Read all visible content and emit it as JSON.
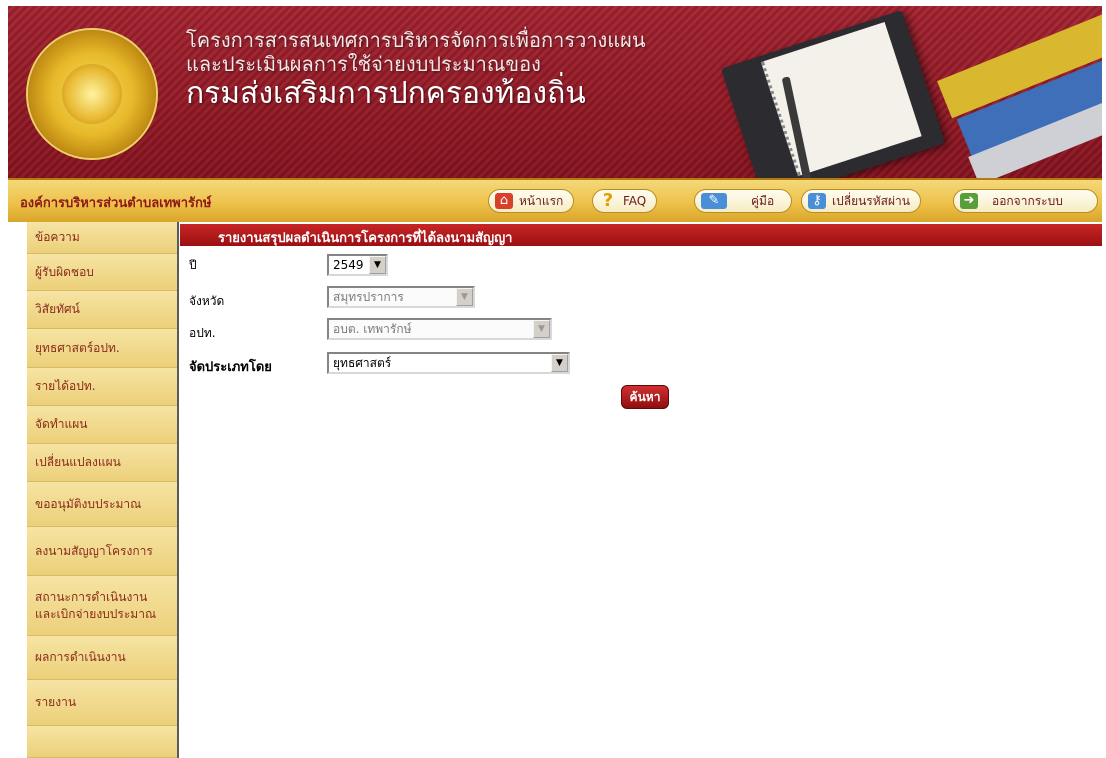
{
  "header": {
    "title_line1": "โครงการสารสนเทศการบริหารจัดการเพื่อการวางแผน",
    "title_line2": "และประเมินผลการใช้จ่ายงบประมาณของ",
    "title_line3": "กรมส่งเสริมการปกครองท้องถิ่น",
    "logo": "department-seal"
  },
  "navbar": {
    "org_name": "องค์การบริหารส่วนตำบลเทพารักษ์",
    "buttons": [
      {
        "label": "หน้าแรก",
        "icon": "home-icon"
      },
      {
        "label": "FAQ",
        "icon": "question-icon"
      },
      {
        "label": "คู่มือ",
        "icon": "manual-icon"
      },
      {
        "label": "เปลี่ยนรหัสผ่าน",
        "icon": "key-icon"
      },
      {
        "label": "ออกจากระบบ",
        "icon": "logout-icon"
      }
    ]
  },
  "sidebar": {
    "items": [
      {
        "label": "ข้อความ"
      },
      {
        "label": "ผู้รับผิดชอบ"
      },
      {
        "label": "วิสัยทัศน์"
      },
      {
        "label": "ยุทธศาสตร์อปท."
      },
      {
        "label": "รายได้อปท."
      },
      {
        "label": "จัดทำแผน"
      },
      {
        "label": "เปลี่ยนแปลงแผน"
      },
      {
        "label": "ขออนุมัติงบประมาณ"
      },
      {
        "label": "ลงนามสัญญาโครงการ"
      },
      {
        "label": "สถานะการดำเนินงาน\nและเบิกจ่ายงบประมาณ"
      },
      {
        "label": "ผลการดำเนินงาน"
      },
      {
        "label": "รายงาน"
      }
    ]
  },
  "report": {
    "title": "รายงานสรุปผลดำเนินการโครงการที่ได้ลงนามสัญญา",
    "fields": {
      "year_label": "ปี",
      "year_value": "2549",
      "province_label": "จังหวัด",
      "province_value": "สมุทรปราการ",
      "org_label": "อปท.",
      "org_value": "อบต. เทพารักษ์",
      "group_label": "จัดประเภทโดย",
      "group_value": "ยุทธศาสตร์"
    },
    "search_label": "ค้นหา"
  },
  "colors": {
    "banner": "#9b1a25",
    "navbar": "#eec24b",
    "sidebar": "#f2dc8e",
    "section_bar": "#b01a1a"
  }
}
